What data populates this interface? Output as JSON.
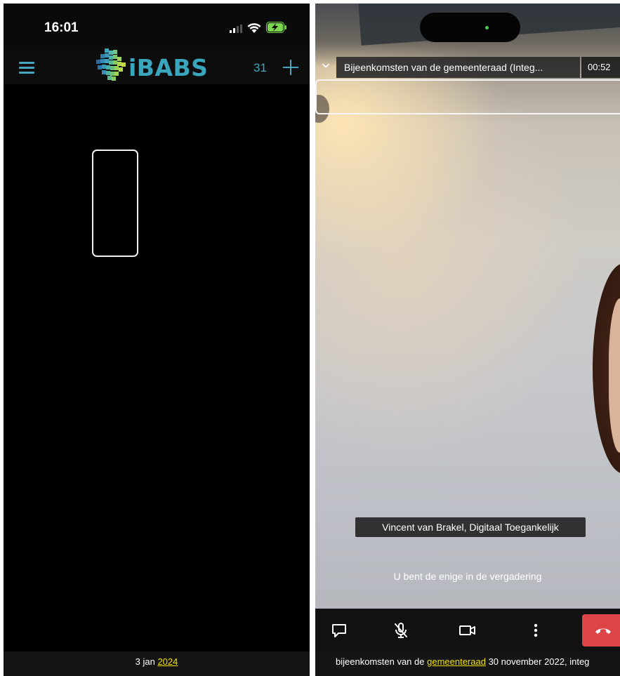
{
  "left_screen": {
    "status_bar": {
      "time": "16:01"
    },
    "app_bar": {
      "logo_text": "iBABS",
      "calendar_count": "31",
      "brand_color": "#3aa6bd"
    },
    "footer": {
      "date_prefix": "3 jan",
      "year_link": "2024"
    }
  },
  "right_screen": {
    "meeting_title": "Bijeenkomsten van de gemeenteraad (Integ...",
    "timer": "00:52",
    "participant_label": "Vincent van Brakel, Digitaal Toegankelijk",
    "status_message": "U bent de enige in de vergadering",
    "toolbar_icons": [
      "chat-icon",
      "mic-off-icon",
      "video-camera-icon",
      "more-vertical-icon",
      "hang-up-icon"
    ],
    "hangup_color": "#dc4448",
    "footer": {
      "text_before": "bijeenkomsten van de",
      "link": "gemeenteraad",
      "text_after": "30 november 2022, integ"
    }
  },
  "link_color": "#f1e000"
}
